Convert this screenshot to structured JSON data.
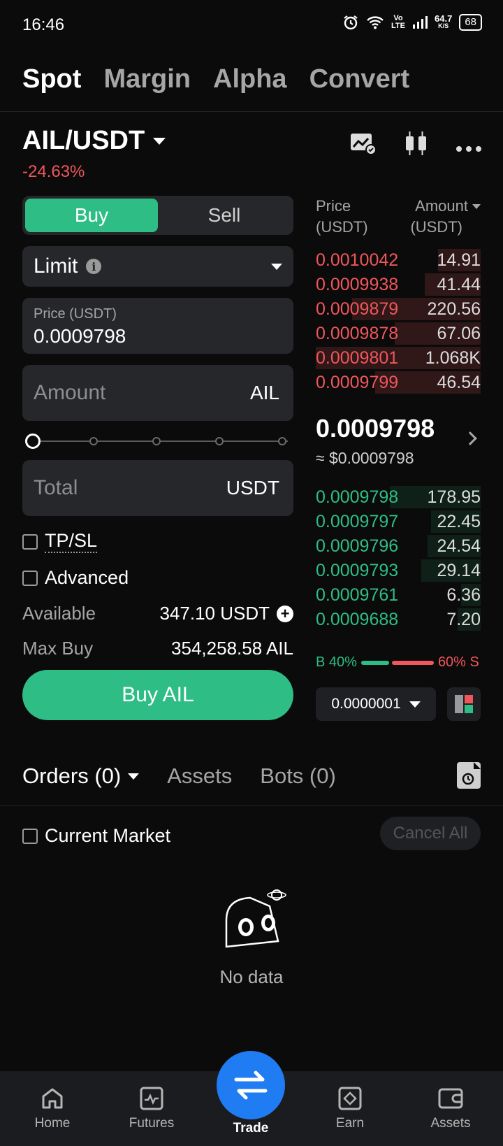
{
  "status_bar": {
    "time": "16:46",
    "net_top": "Vo",
    "net_bottom": "LTE",
    "speed_top": "64.7",
    "speed_bottom": "K/S",
    "battery": "68"
  },
  "top_tabs": [
    "Spot",
    "Margin",
    "Alpha",
    "Convert"
  ],
  "pair": {
    "symbol": "AIL/USDT",
    "change": "-24.63%"
  },
  "order_form": {
    "buy_label": "Buy",
    "sell_label": "Sell",
    "order_type": "Limit",
    "info_glyph": "i",
    "price_label": "Price (USDT)",
    "price_value": "0.0009798",
    "amount_placeholder": "Amount",
    "amount_unit": "AIL",
    "total_placeholder": "Total",
    "total_unit": "USDT",
    "tpsl_label": "TP/SL",
    "advanced_label": "Advanced",
    "available_label": "Available",
    "available_value": "347.10 USDT",
    "plus_glyph": "+",
    "maxbuy_label": "Max Buy",
    "maxbuy_value": "354,258.58 AIL",
    "buy_button": "Buy AIL"
  },
  "order_book": {
    "price_header_1": "Price",
    "price_header_2": "(USDT)",
    "amount_header_1": "Amount",
    "amount_header_2": "(USDT)",
    "asks": [
      {
        "price": "0.0010042",
        "amount": "14.91"
      },
      {
        "price": "0.0009938",
        "amount": "41.44"
      },
      {
        "price": "0.0009879",
        "amount": "220.56"
      },
      {
        "price": "0.0009878",
        "amount": "67.06"
      },
      {
        "price": "0.0009801",
        "amount": "1.068K"
      },
      {
        "price": "0.0009799",
        "amount": "46.54"
      }
    ],
    "mid_price": "0.0009798",
    "mid_usd": "≈ $0.0009798",
    "bids": [
      {
        "price": "0.0009798",
        "amount": "178.95"
      },
      {
        "price": "0.0009797",
        "amount": "22.45"
      },
      {
        "price": "0.0009796",
        "amount": "24.54"
      },
      {
        "price": "0.0009793",
        "amount": "29.14"
      },
      {
        "price": "0.0009761",
        "amount": "6.36"
      },
      {
        "price": "0.0009688",
        "amount": "7.20"
      }
    ],
    "buy_ratio": "B 40%",
    "sell_ratio": "60% S",
    "buy_fraction": 0.4,
    "tick_size": "0.0000001"
  },
  "orders": {
    "tab_orders": "Orders (0)",
    "tab_assets": "Assets",
    "tab_bots": "Bots (0)",
    "current_market": "Current Market",
    "cancel_all": "Cancel All",
    "empty_text": "No data"
  },
  "bottom_nav": {
    "home": "Home",
    "futures": "Futures",
    "trade": "Trade",
    "earn": "Earn",
    "assets": "Assets"
  },
  "colors": {
    "buy_green": "#2ebd85",
    "sell_red": "#f0565b",
    "trade_blue": "#1f7cf3"
  }
}
